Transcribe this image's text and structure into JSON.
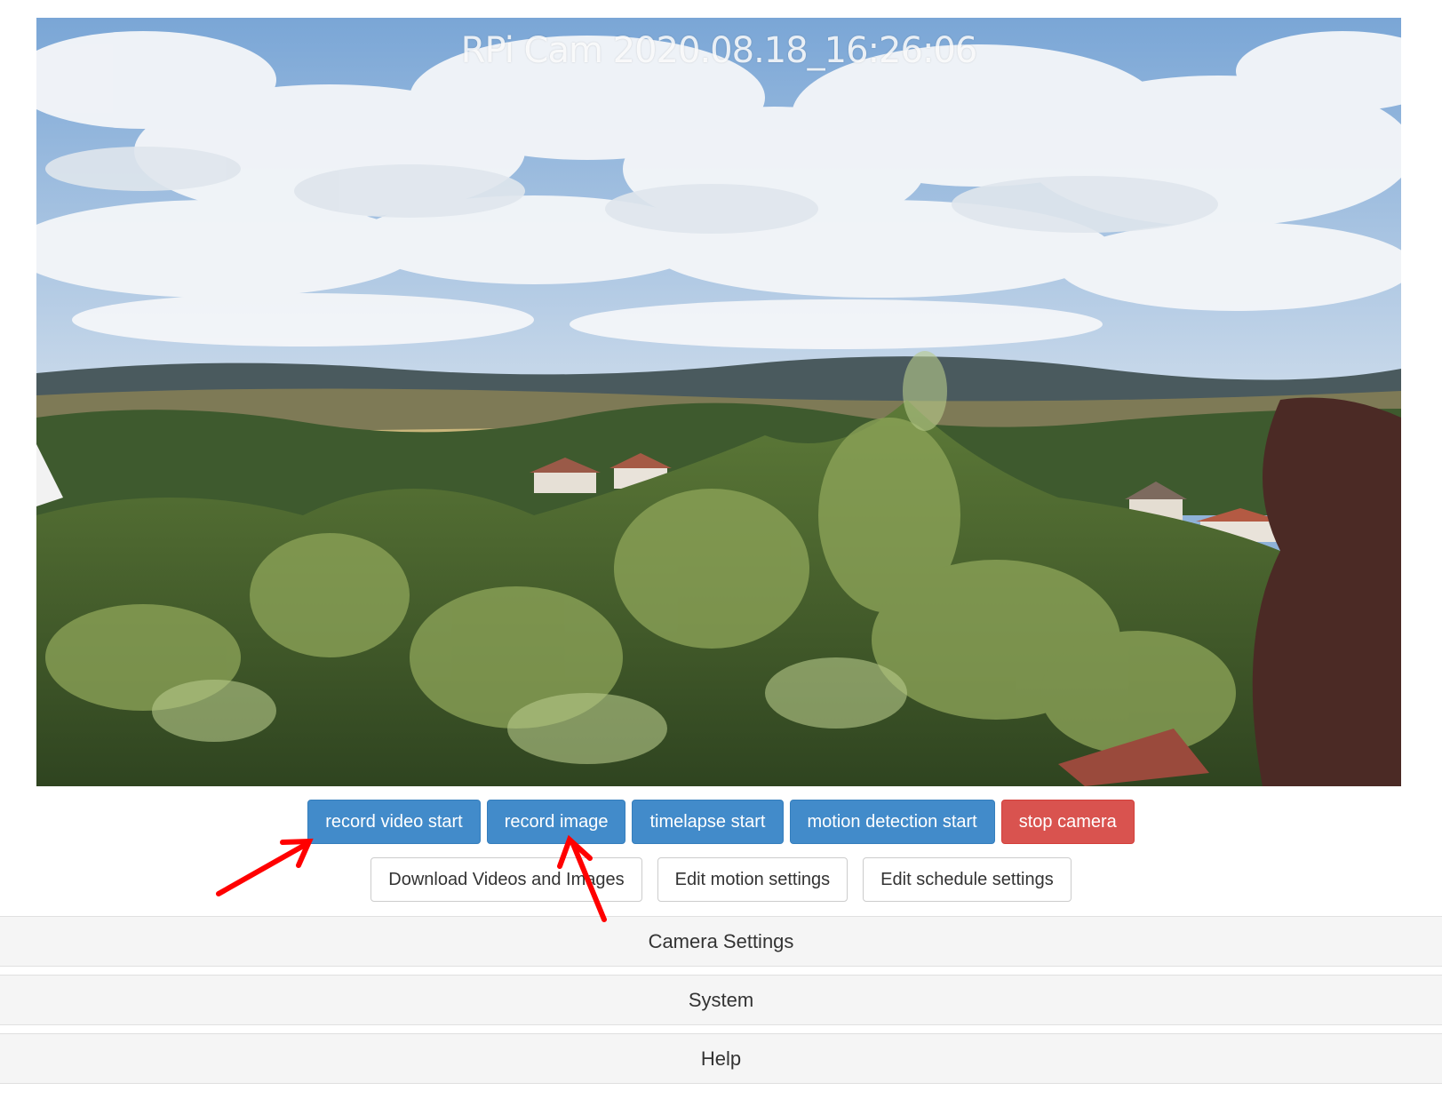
{
  "preview": {
    "overlay_text": "RPi  Cam  2020.08.18_16:26:06"
  },
  "buttons_primary": [
    {
      "label": "record video start",
      "style": "primary"
    },
    {
      "label": "record image",
      "style": "primary"
    },
    {
      "label": "timelapse start",
      "style": "primary"
    },
    {
      "label": "motion detection start",
      "style": "primary"
    },
    {
      "label": "stop camera",
      "style": "danger"
    }
  ],
  "buttons_secondary": [
    {
      "label": "Download Videos and Images"
    },
    {
      "label": "Edit motion settings"
    },
    {
      "label": "Edit schedule settings"
    }
  ],
  "panels": [
    {
      "label": "Camera Settings"
    },
    {
      "label": "System"
    },
    {
      "label": "Help"
    }
  ],
  "colors": {
    "primary": "#428bca",
    "danger": "#d9534f",
    "arrow": "#ff0000"
  }
}
